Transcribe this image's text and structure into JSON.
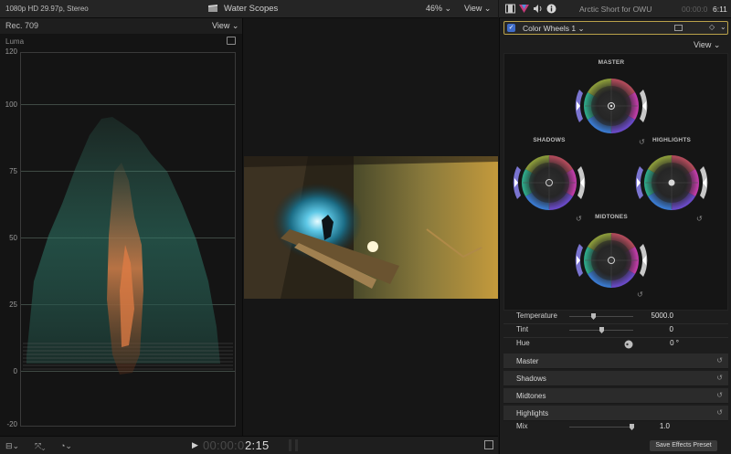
{
  "viewer_header": {
    "format": "1080p HD 29.97p, Stereo",
    "title": "Water Scopes",
    "zoom": "46%",
    "view_label": "View"
  },
  "inspector_header": {
    "project": "Arctic Short for OWU",
    "duration_dim": "00:00:0",
    "duration": "6:11"
  },
  "scope": {
    "standard": "Rec. 709",
    "view_label": "View",
    "mode_label": "Luma",
    "y_ticks": [
      "120",
      "100",
      "75",
      "50",
      "25",
      "0",
      "-20"
    ]
  },
  "playback": {
    "timecode_dim": "00:00:0",
    "timecode": "2:15"
  },
  "inspector": {
    "effect_name": "Color Wheels 1",
    "view_label": "View",
    "wheels": {
      "master": "MASTER",
      "shadows": "SHADOWS",
      "highlights": "HIGHLIGHTS",
      "midtones": "MIDTONES"
    },
    "params": [
      {
        "label": "Temperature",
        "value": "5000.0",
        "slider_fraction": 0.35
      },
      {
        "label": "Tint",
        "value": "0",
        "slider_fraction": 0.5
      },
      {
        "label": "Hue",
        "value": "0 °"
      }
    ],
    "sections": [
      "Master",
      "Shadows",
      "Midtones",
      "Highlights"
    ],
    "mix": {
      "label": "Mix",
      "value": "1.0",
      "slider_fraction": 1.0
    },
    "save_preset": "Save Effects Preset"
  },
  "colors": {
    "accent_yellow": "#b9a14a",
    "checkbox_blue": "#3f6cc8"
  }
}
